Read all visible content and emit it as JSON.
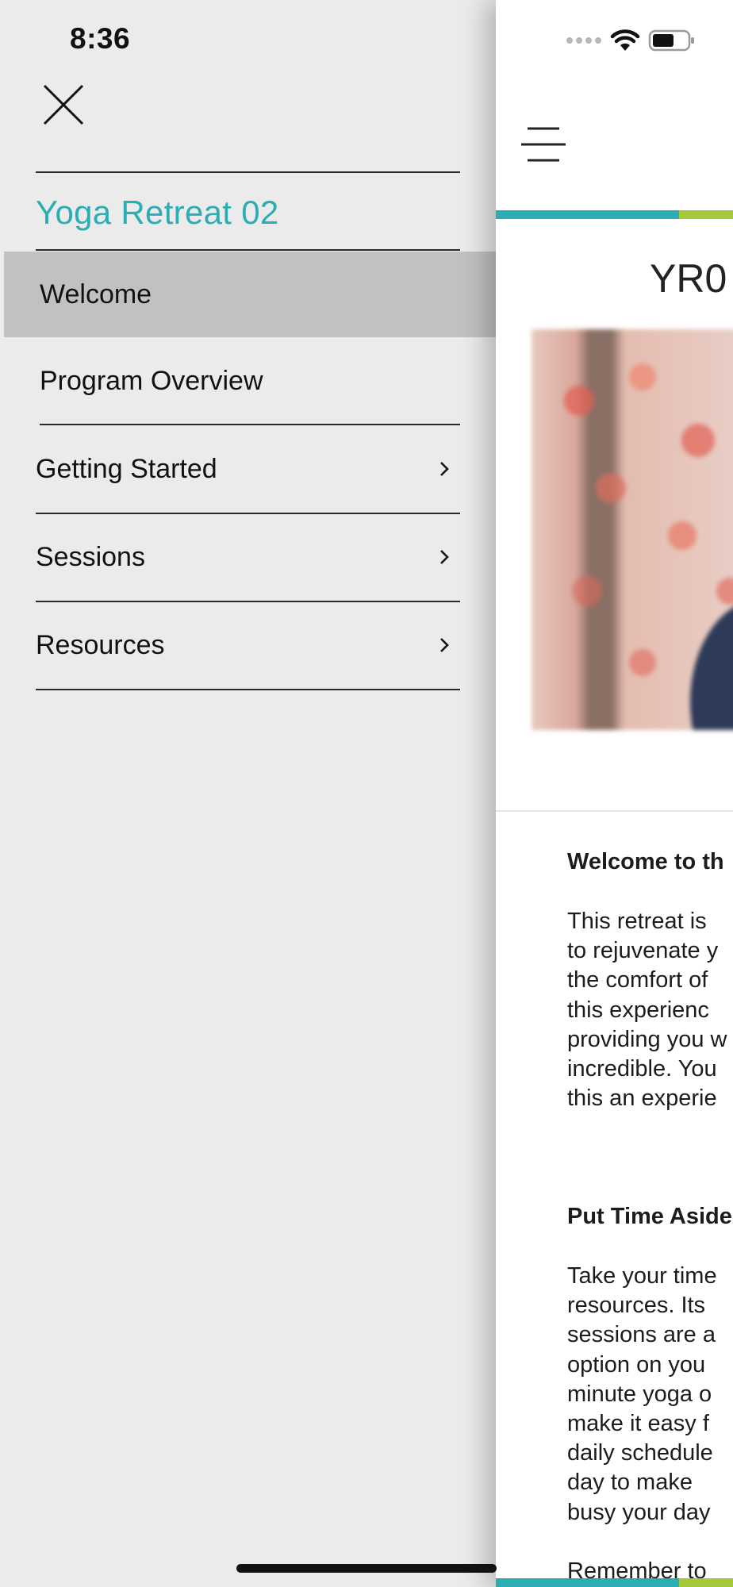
{
  "status_bar": {
    "time": "8:36"
  },
  "drawer": {
    "close_icon": "close-icon",
    "title": "Yoga Retreat 02",
    "items": [
      {
        "label": "Welcome",
        "active": true,
        "has_submenu": false
      },
      {
        "label": "Program Overview",
        "active": false,
        "has_submenu": false
      },
      {
        "label": "Getting Started",
        "active": false,
        "has_submenu": true
      },
      {
        "label": "Sessions",
        "active": false,
        "has_submenu": true
      },
      {
        "label": "Resources",
        "active": false,
        "has_submenu": true
      }
    ]
  },
  "colors": {
    "accent_teal": "#2aadb3",
    "accent_green": "#a5c93a",
    "drawer_bg": "#ebebeb",
    "active_item_bg": "#c1c1c3"
  },
  "content": {
    "menu_icon": "hamburger-menu-icon",
    "heading": "YR0",
    "sections": [
      {
        "heading": "Welcome to th",
        "lines": [
          "This retreat is",
          "to rejuvenate y",
          "the comfort of",
          "this  experienc",
          "providing you w",
          "incredible. You",
          "this an experie"
        ]
      },
      {
        "heading": "Put Time Aside",
        "lines": [
          "Take your time",
          "resources. Its",
          "sessions are a",
          "option on you",
          "minute yoga o",
          "make it easy f",
          "daily schedule",
          "day to make",
          "busy your day"
        ]
      }
    ],
    "trailing_line": "Remember  to"
  }
}
